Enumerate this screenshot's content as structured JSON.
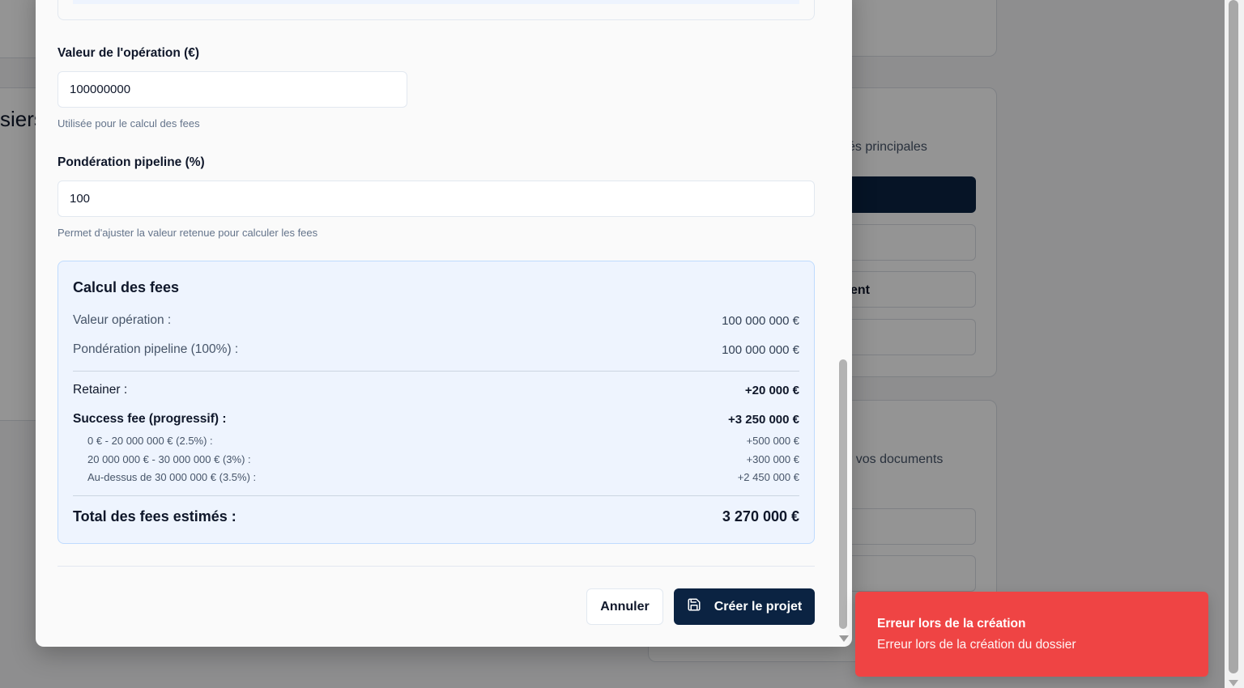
{
  "background": {
    "left_heading_fragment": "siers",
    "card_text_1": "és principales",
    "card_bold_fragment": "ent",
    "card_text_2": "r vos documents"
  },
  "form": {
    "operation_value": {
      "label": "Valeur de l'opération (€)",
      "value": "100000000",
      "hint": "Utilisée pour le calcul des fees"
    },
    "pipeline_weighting": {
      "label": "Pondération pipeline (%)",
      "value": "100",
      "hint": "Permet d'ajuster la valeur retenue pour calculer les fees"
    }
  },
  "fees": {
    "title": "Calcul des fees",
    "operation_value": {
      "label": "Valeur opération :",
      "value": "100 000 000 €"
    },
    "pipeline_weighting": {
      "label": "Pondération pipeline (100%) :",
      "value": "100 000 000 €"
    },
    "retainer": {
      "label": "Retainer :",
      "value": "+20 000 €"
    },
    "success_fee": {
      "label": "Success fee (progressif) :",
      "value": "+3 250 000 €"
    },
    "tiers": [
      {
        "label": "0 € - 20 000 000 € (2.5%) :",
        "value": "+500 000 €"
      },
      {
        "label": "20 000 000 € - 30 000 000 € (3%) :",
        "value": "+300 000 €"
      },
      {
        "label": "Au-dessus de 30 000 000 € (3.5%) :",
        "value": "+2 450 000 €"
      }
    ],
    "total": {
      "label": "Total des fees estimés :",
      "value": "3 270 000 €"
    }
  },
  "actions": {
    "cancel_label": "Annuler",
    "create_label": "Créer le projet",
    "create_icon": "save-icon"
  },
  "toast": {
    "title": "Erreur lors de la création",
    "message": "Erreur lors de la création du dossier",
    "color": "#ef4444"
  },
  "colors": {
    "primary": "#0b2342",
    "calc_bg": "#eef4fe",
    "error": "#ef4444"
  }
}
